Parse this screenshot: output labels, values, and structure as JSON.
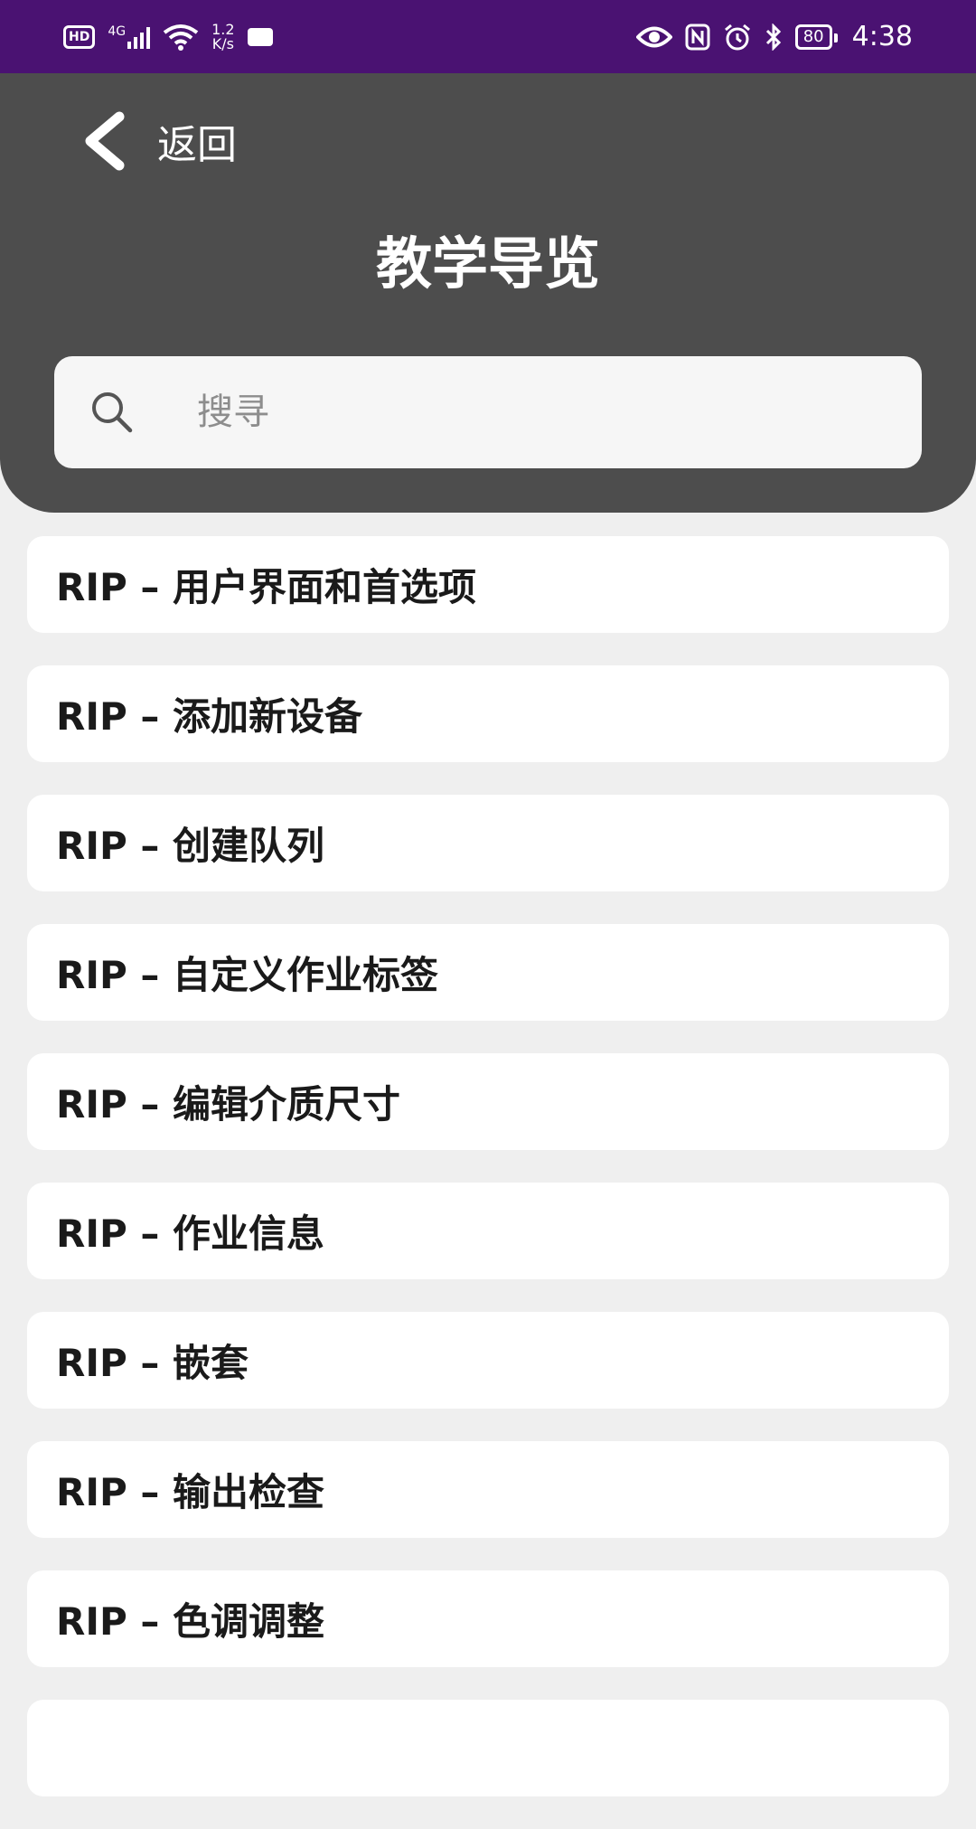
{
  "status_bar": {
    "hd": "HD",
    "network": "4G",
    "speed_value": "1.2",
    "speed_unit": "K/s",
    "battery": "80",
    "time": "4:38",
    "icons": [
      "hd-icon",
      "signal-icon",
      "wifi-icon",
      "message-icon",
      "eye-icon",
      "nfc-icon",
      "alarm-icon",
      "bluetooth-icon",
      "battery-icon"
    ]
  },
  "header": {
    "back_label": "返回",
    "title": "教学导览"
  },
  "search": {
    "placeholder": "搜寻"
  },
  "list": {
    "items": [
      "RIP – 用户界面和首选项",
      "RIP – 添加新设备",
      "RIP – 创建队列",
      "RIP – 自定义作业标签",
      "RIP – 编辑介质尺寸",
      "RIP – 作业信息",
      "RIP – 嵌套",
      "RIP – 输出检查",
      "RIP – 色调调整",
      ""
    ]
  },
  "colors": {
    "status_bar": "#4a1272",
    "header": "#4d4d4d",
    "background": "#efefef",
    "card": "#ffffff"
  }
}
